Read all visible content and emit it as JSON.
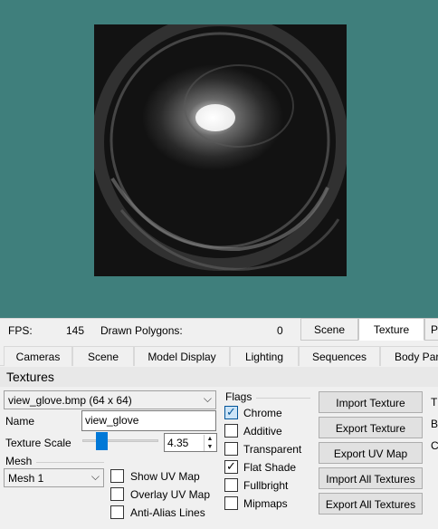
{
  "status": {
    "fps_label": "FPS:",
    "fps_value": "145",
    "polys_label": "Drawn Polygons:",
    "polys_value": "0"
  },
  "top_tabs": [
    "Scene",
    "Texture",
    "P"
  ],
  "tabs": [
    "Cameras",
    "Scene",
    "Model Display",
    "Lighting",
    "Sequences",
    "Body Par"
  ],
  "panel_title": "Textures",
  "texture_select": "view_glove.bmp (64 x 64)",
  "name_label": "Name",
  "name_value": "view_glove",
  "scale_label": "Texture Scale",
  "scale_value": "4.35",
  "scale_level": 0.24,
  "mesh_label": "Mesh",
  "mesh_select": "Mesh 1",
  "mesh_checks": [
    {
      "label": "Show UV Map",
      "checked": false
    },
    {
      "label": "Overlay UV Map",
      "checked": false
    },
    {
      "label": "Anti-Alias Lines",
      "checked": false
    }
  ],
  "flags_label": "Flags",
  "flags": [
    {
      "label": "Chrome",
      "checked": true
    },
    {
      "label": "Additive",
      "checked": false
    },
    {
      "label": "Transparent",
      "checked": false
    },
    {
      "label": "Flat Shade",
      "checked": true
    },
    {
      "label": "Fullbright",
      "checked": false
    },
    {
      "label": "Mipmaps",
      "checked": false
    }
  ],
  "buttons": [
    "Import Texture",
    "Export Texture",
    "Export UV Map",
    "Import All Textures",
    "Export All Textures"
  ],
  "right_cut": [
    "T",
    "B",
    "C"
  ]
}
